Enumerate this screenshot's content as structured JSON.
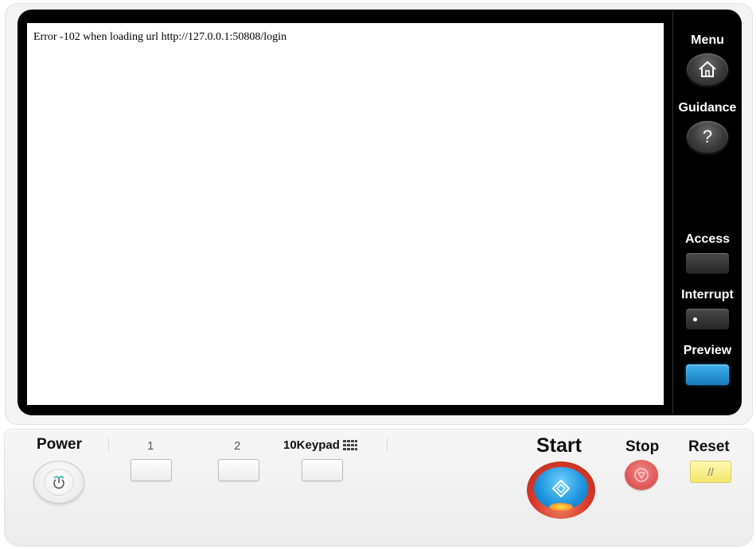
{
  "screen": {
    "message": "Error -102 when loading url http://127.0.0.1:50808/login"
  },
  "side_panel": {
    "menu_label": "Menu",
    "guidance_label": "Guidance",
    "guidance_glyph": "?",
    "access_label": "Access",
    "interrupt_label": "Interrupt",
    "preview_label": "Preview",
    "preview_color": "#1f97dd",
    "menu_icon": "home-icon"
  },
  "control_panel": {
    "power_label": "Power",
    "key1_label": "1",
    "key2_label": "2",
    "keypad_label": "10Keypad",
    "start_label": "Start",
    "stop_label": "Stop",
    "reset_label": "Reset",
    "reset_glyph": "//",
    "start_color": "#1b92dc",
    "stop_color": "#e05a5a",
    "reset_color": "#f2e66a"
  }
}
